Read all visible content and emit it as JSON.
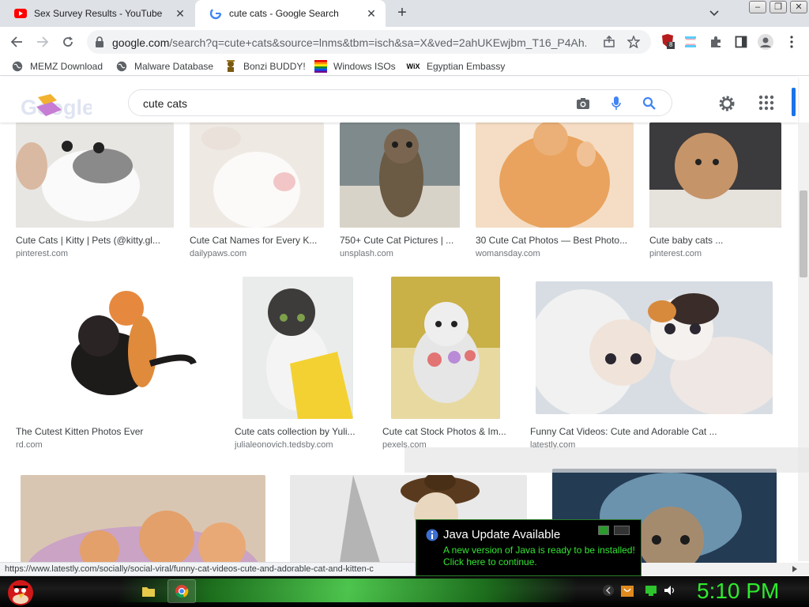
{
  "tabs": [
    {
      "title": "Sex Survey Results - YouTube",
      "active": false,
      "favicon": "youtube-icon"
    },
    {
      "title": "cute cats - Google Search",
      "active": true,
      "favicon": "google-g-icon"
    }
  ],
  "address": {
    "domain": "google.com",
    "path": "/search?q=cute+cats&source=lnms&tbm=isch&sa=X&ved=2ahUKEwjbm_T16_P4Ah..."
  },
  "extensions": {
    "badge": "8"
  },
  "bookmarks": [
    {
      "label": "MEMZ Download",
      "icon": "globe-icon"
    },
    {
      "label": "Malware Database",
      "icon": "globe-icon"
    },
    {
      "label": "Bonzi BUDDY!",
      "icon": "bonzi-icon"
    },
    {
      "label": "Windows ISOs",
      "icon": "windows-flag-icon"
    },
    {
      "label": "Egyptian Embassy",
      "icon": "wix-icon"
    }
  ],
  "search": {
    "query": "cute cats"
  },
  "results": [
    {
      "title": "Cute Cats | Kitty | Pets (@kitty.gl...",
      "site": "pinterest.com"
    },
    {
      "title": "Cute Cat Names for Every K...",
      "site": "dailypaws.com"
    },
    {
      "title": "750+ Cute Cat Pictures | ...",
      "site": "unsplash.com"
    },
    {
      "title": "30 Cute Cat Photos — Best Photo...",
      "site": "womansday.com"
    },
    {
      "title": "Cute baby cats ...",
      "site": "pinterest.com"
    },
    {
      "title": "The Cutest Kitten Photos Ever",
      "site": "rd.com"
    },
    {
      "title": "Cute cats collection by Yuli...",
      "site": "julialeonovich.tedsby.com"
    },
    {
      "title": "Cute cat Stock Photos & Im...",
      "site": "pexels.com"
    },
    {
      "title": "Funny Cat Videos: Cute and Adorable Cat ...",
      "site": "latestly.com"
    }
  ],
  "status_url": "https://www.latestly.com/socially/social-viral/funny-cat-videos-cute-and-adorable-cat-and-kitten-c",
  "java_popup": {
    "title": "Java Update Available",
    "line1": "A new version of Java is ready to be installed!",
    "line2": "Click here to continue."
  },
  "taskbar": {
    "clock": "5:10 PM"
  },
  "colors": {
    "clock": "#2eea2e",
    "java_text": "#34e634",
    "google_blue": "#1a73e8"
  }
}
